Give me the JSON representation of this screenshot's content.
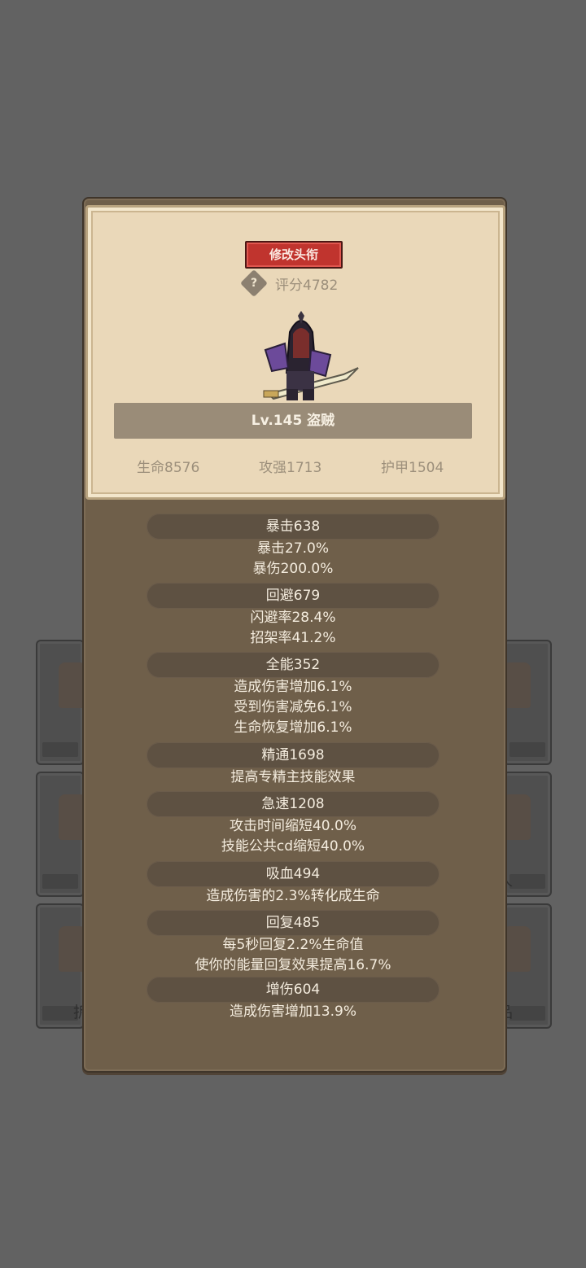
{
  "background": {
    "right_tile_labels": [
      "人",
      "品"
    ],
    "left_tile_labels": [
      "拆"
    ]
  },
  "header": {
    "title_button": "修改头衔",
    "help_icon": "?",
    "score": "评分4782"
  },
  "hero": {
    "name": "Lv.145 盗贼",
    "stats": {
      "hp": "生命8576",
      "attack": "攻强1713",
      "armor": "护甲1504"
    }
  },
  "sections": [
    {
      "title": "暴击638",
      "lines": [
        "暴击27.0%",
        "暴伤200.0%"
      ]
    },
    {
      "title": "回避679",
      "lines": [
        "闪避率28.4%",
        "招架率41.2%"
      ]
    },
    {
      "title": "全能352",
      "lines": [
        "造成伤害增加6.1%",
        "受到伤害减免6.1%",
        "生命恢复增加6.1%"
      ]
    },
    {
      "title": "精通1698",
      "lines": [
        "提高专精主技能效果"
      ]
    },
    {
      "title": "急速1208",
      "lines": [
        "攻击时间缩短40.0%",
        "技能公共cd缩短40.0%"
      ]
    },
    {
      "title": "吸血494",
      "lines": [
        "造成伤害的2.3%转化成生命"
      ]
    },
    {
      "title": "回复485",
      "lines": [
        "每5秒回复2.2%生命值",
        "使你的能量回复效果提高16.7%"
      ]
    },
    {
      "title": "增伤604",
      "lines": [
        "造成伤害增加13.9%"
      ]
    }
  ]
}
